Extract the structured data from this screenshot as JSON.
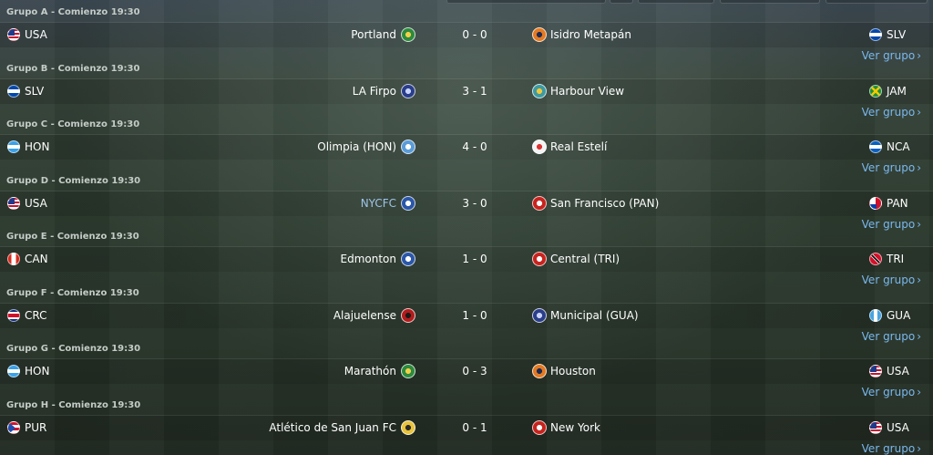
{
  "groups": [
    {
      "header": "Grupo A - Comienzo 19:30",
      "home_code": "USA",
      "home_flag": "usa",
      "home_team": "Portland",
      "home_link": false,
      "home_crest": "green",
      "score": "0 - 0",
      "away_team": "Isidro Metapán",
      "away_crest": "orange",
      "away_code": "SLV",
      "away_flag": "slv",
      "link": "Ver grupo"
    },
    {
      "header": "Grupo B - Comienzo 19:30",
      "home_code": "SLV",
      "home_flag": "slv",
      "home_team": "LA Firpo",
      "home_link": false,
      "home_crest": "navy",
      "score": "3 - 1",
      "away_team": "Harbour View",
      "away_crest": "teal",
      "away_code": "JAM",
      "away_flag": "jam",
      "link": "Ver grupo"
    },
    {
      "header": "Grupo C - Comienzo 19:30",
      "home_code": "HON",
      "home_flag": "hon",
      "home_team": "Olimpia (HON)",
      "home_link": false,
      "home_crest": "skyblue",
      "score": "4 - 0",
      "away_team": "Real Estelí",
      "away_crest": "white",
      "away_code": "NCA",
      "away_flag": "nca",
      "link": "Ver grupo"
    },
    {
      "header": "Grupo D - Comienzo 19:30",
      "home_code": "USA",
      "home_flag": "usa",
      "home_team": "NYCFC",
      "home_link": true,
      "home_crest": "blue",
      "score": "3 - 0",
      "away_team": "San Francisco (PAN)",
      "away_crest": "red",
      "away_code": "PAN",
      "away_flag": "pan",
      "link": "Ver grupo"
    },
    {
      "header": "Grupo E - Comienzo 19:30",
      "home_code": "CAN",
      "home_flag": "can",
      "home_team": "Edmonton",
      "home_link": false,
      "home_crest": "blue",
      "score": "1 - 0",
      "away_team": "Central (TRI)",
      "away_crest": "red",
      "away_code": "TRI",
      "away_flag": "tri",
      "link": "Ver grupo"
    },
    {
      "header": "Grupo F - Comienzo 19:30",
      "home_code": "CRC",
      "home_flag": "crc",
      "home_team": "Alajuelense",
      "home_link": false,
      "home_crest": "darkred",
      "score": "1 - 0",
      "away_team": "Municipal (GUA)",
      "away_crest": "navy",
      "away_code": "GUA",
      "away_flag": "gua",
      "link": "Ver grupo"
    },
    {
      "header": "Grupo G - Comienzo 19:30",
      "home_code": "HON",
      "home_flag": "hon",
      "home_team": "Marathón",
      "home_link": false,
      "home_crest": "green",
      "score": "0 - 3",
      "away_team": "Houston",
      "away_crest": "orange",
      "away_code": "USA",
      "away_flag": "usa",
      "link": "Ver grupo"
    },
    {
      "header": "Grupo H - Comienzo 19:30",
      "home_code": "PUR",
      "home_flag": "pur",
      "home_team": "Atlético de San Juan FC",
      "home_link": false,
      "home_crest": "yellow",
      "score": "0 - 1",
      "away_team": "New York",
      "away_crest": "red",
      "away_code": "USA",
      "away_flag": "usa",
      "link": "Ver grupo"
    }
  ]
}
